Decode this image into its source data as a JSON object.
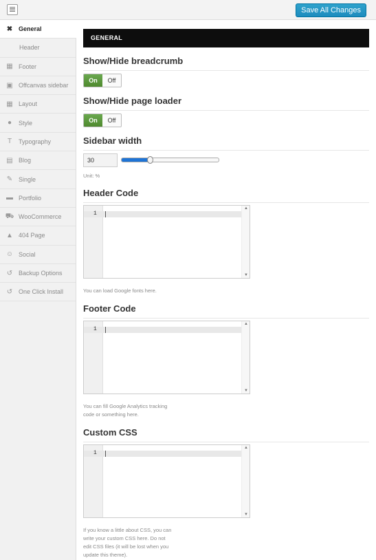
{
  "toolbar": {
    "save_label": "Save All Changes"
  },
  "sidebar": {
    "items": [
      {
        "label": "General",
        "icon": "tools-icon",
        "glyph": "✖",
        "active": true
      },
      {
        "label": "Header",
        "icon": "none",
        "glyph": "",
        "sub": true
      },
      {
        "label": "Footer",
        "icon": "footer-icon",
        "glyph": "▦"
      },
      {
        "label": "Offcanvas sidebar",
        "icon": "sidebar-icon",
        "glyph": "▣"
      },
      {
        "label": "Layout",
        "icon": "grid-icon",
        "glyph": "▦"
      },
      {
        "label": "Style",
        "icon": "palette-icon",
        "glyph": "●"
      },
      {
        "label": "Typography",
        "icon": "type-icon",
        "glyph": "T"
      },
      {
        "label": "Blog",
        "icon": "blog-icon",
        "glyph": "▤"
      },
      {
        "label": "Single",
        "icon": "edit-icon",
        "glyph": "✎"
      },
      {
        "label": "Portfolio",
        "icon": "briefcase-icon",
        "glyph": "▬"
      },
      {
        "label": "WooCommerce",
        "icon": "cart-icon",
        "glyph": "⛟"
      },
      {
        "label": "404 Page",
        "icon": "warning-icon",
        "glyph": "▲"
      },
      {
        "label": "Social",
        "icon": "users-icon",
        "glyph": "☺"
      },
      {
        "label": "Backup Options",
        "icon": "history-icon",
        "glyph": "↺"
      },
      {
        "label": "One Click Install",
        "icon": "history-icon",
        "glyph": "↺"
      }
    ]
  },
  "main": {
    "section_title": "GENERAL",
    "breadcrumb": {
      "title": "Show/Hide breadcrumb",
      "on": "On",
      "off": "Off",
      "value": "On"
    },
    "loader": {
      "title": "Show/Hide page loader",
      "on": "On",
      "off": "Off",
      "value": "On"
    },
    "sidebar_width": {
      "title": "Sidebar width",
      "value": "30",
      "help": "Unit: %",
      "fraction": 0.3
    },
    "header_code": {
      "title": "Header Code",
      "line_number": "1",
      "help": "You can load Google fonts here."
    },
    "footer_code": {
      "title": "Footer Code",
      "line_number": "1",
      "help_1": "You can fill Google Analytics tracking",
      "help_2": "code or something here."
    },
    "custom_css": {
      "title": "Custom CSS",
      "line_number": "1",
      "help_1": "If you know a little about CSS, you can",
      "help_2": "write your custom CSS here. Do not",
      "help_3": "edit CSS files (it will be lost when you",
      "help_4": "update this theme)."
    }
  }
}
